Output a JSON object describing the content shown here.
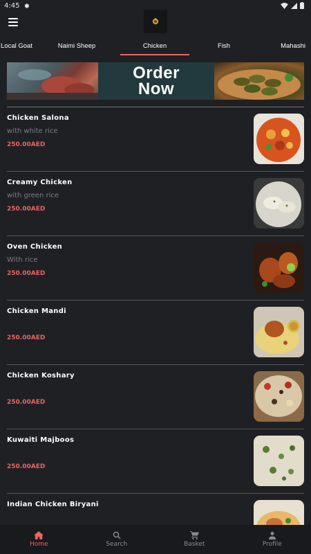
{
  "status_bar": {
    "time": "4:45"
  },
  "tabs": [
    {
      "label": "Local Goat"
    },
    {
      "label": "Naimi Sheep"
    },
    {
      "label": "Chicken"
    },
    {
      "label": "Fish"
    },
    {
      "label": "Mahashi"
    }
  ],
  "active_tab_index": 2,
  "banner": {
    "text_line1": "Order",
    "text_line2": "Now"
  },
  "menu_items": [
    {
      "name": "Chicken Salona",
      "description": "with white rice",
      "price": "250.00AED",
      "image_icon": "chicken-salona-photo"
    },
    {
      "name": "Creamy Chicken",
      "description": "with green rice",
      "price": "250.00AED",
      "image_icon": "creamy-chicken-photo"
    },
    {
      "name": "Oven Chicken",
      "description": "With rice",
      "price": "250.00AED",
      "image_icon": "oven-chicken-photo"
    },
    {
      "name": "Chicken Mandi",
      "description": "",
      "price": "250.00AED",
      "image_icon": "chicken-mandi-photo"
    },
    {
      "name": "Chicken Koshary",
      "description": "",
      "price": "250.00AED",
      "image_icon": "chicken-koshary-photo"
    },
    {
      "name": "Kuwaiti Majboos",
      "description": "",
      "price": "250.00AED",
      "image_icon": "kuwaiti-majboos-photo"
    },
    {
      "name": "Indian Chicken Biryani",
      "description": "",
      "price": "",
      "image_icon": "chicken-biryani-photo"
    }
  ],
  "bottom_nav": {
    "home": "Home",
    "search": "Search",
    "basket": "Basket",
    "profile": "Profile"
  },
  "colors": {
    "background": "#1f2024",
    "accent": "#e8655f",
    "muted_text": "#7c7d82",
    "nav_background": "#191a1d"
  }
}
